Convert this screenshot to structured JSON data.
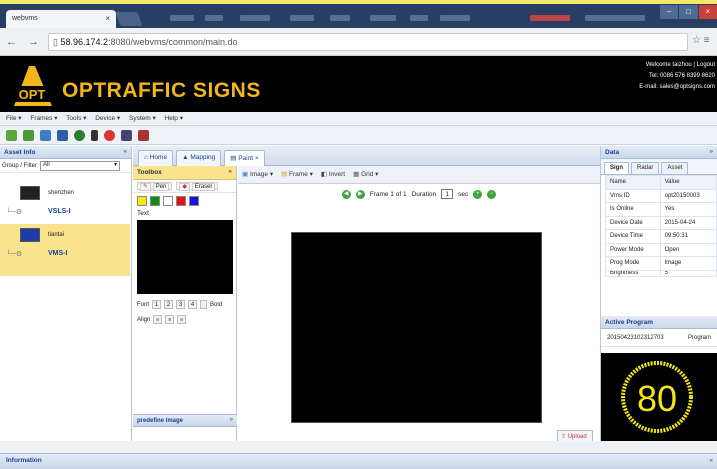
{
  "browser": {
    "tab_title": "webvms",
    "url_host": "58.96.174.2",
    "url_path": ":8080/webvms/common/main.do",
    "nav_icons": "← → C"
  },
  "header": {
    "brand": "OPTRAFFIC SIGNS",
    "logo_text": "OPT",
    "welcome": "Welcome taizhou | Logout",
    "tel": "Tel: 0086 576 8399 8620",
    "email": "E-mail: sales@optsigns.com"
  },
  "menu": {
    "file": "File ▾",
    "frames": "Frames ▾",
    "tools": "Tools ▾",
    "device": "Device ▾",
    "system": "System ▾",
    "help": "Help ▾"
  },
  "asset_panel": {
    "title": "Asset Info",
    "group_label": "Group / Filter",
    "group_value": "All",
    "nodes": [
      {
        "name": "shenzhen",
        "sign": "VSLS-I"
      },
      {
        "name": "tiantai",
        "sign": "VMS-I"
      }
    ]
  },
  "center_tabs": {
    "home": "Home",
    "mapping": "Mapping",
    "paint": "Paint ×"
  },
  "toolbox": {
    "title": "Toolbox",
    "pen": "Pen",
    "eraser": "Eraser",
    "colors": [
      "#f5e614",
      "#0f8a12",
      "#ffffff",
      "#e41111",
      "#1414d8"
    ],
    "text_label": "Text",
    "font_label": "Font",
    "font_sizes": [
      "1",
      "2",
      "3",
      "4"
    ],
    "bold_label": "Bold",
    "align_label": "Align",
    "predefine": "predefine image"
  },
  "paint": {
    "image_btn": "Image ▾",
    "frame_btn": "Frame ▾",
    "invert_btn": "Invert",
    "grid_btn": "Grid ▾",
    "frame_text": "Frame 1 of 1",
    "duration_label": "Duration",
    "duration_value": "1",
    "sec": "sec",
    "upload": "Upload"
  },
  "data_panel": {
    "title": "Data",
    "tabs": [
      "Sign",
      "Radar",
      "Asset"
    ],
    "header": [
      "Name",
      "Value"
    ],
    "rows": [
      [
        "Vms ID",
        "opt20150003"
      ],
      [
        "Is Online",
        "Yes"
      ],
      [
        "Device Date",
        "2015-04-24"
      ],
      [
        "Device Time",
        "09:50:31"
      ],
      [
        "Power Mode",
        "Open"
      ],
      [
        "Prog Mode",
        "Image"
      ],
      [
        "Brightness",
        "5"
      ]
    ],
    "active_program_title": "Active Program",
    "program_id": "20150423102312703",
    "program_label": "Program",
    "preview_text": "80"
  },
  "info": {
    "title": "Information"
  }
}
